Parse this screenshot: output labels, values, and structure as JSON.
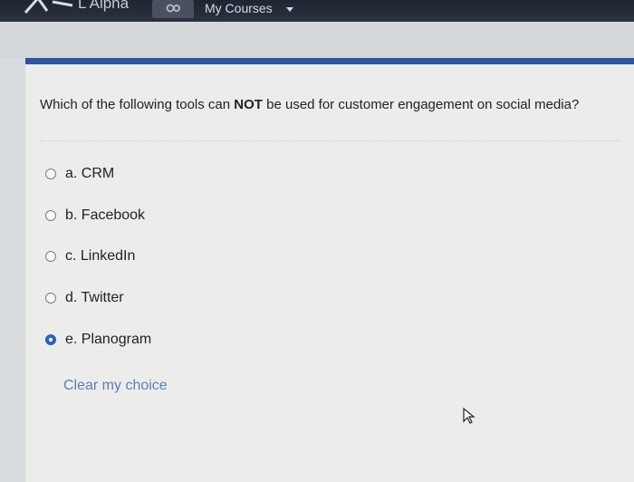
{
  "header": {
    "brand": "L Alpha",
    "courses_label": "My Courses",
    "courses_icon": "gear-icon"
  },
  "question": {
    "prefix": "Which of the following tools can ",
    "emphasis": "NOT",
    "suffix": " be used for customer engagement on social media?"
  },
  "options": [
    {
      "label": "a. CRM",
      "selected": false
    },
    {
      "label": "b. Facebook",
      "selected": false
    },
    {
      "label": "c. LinkedIn",
      "selected": false
    },
    {
      "label": "d. Twitter",
      "selected": false
    },
    {
      "label": "e. Planogram",
      "selected": true
    }
  ],
  "clear_label": "Clear my choice",
  "colors": {
    "accent": "#2d55a0",
    "selected_radio": "#2b66c8",
    "link": "#5a7fb5"
  }
}
